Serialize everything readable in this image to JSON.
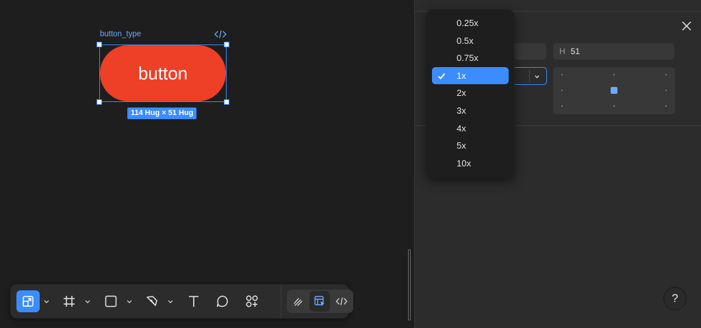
{
  "canvas": {
    "frame_name": "button_type",
    "button_label": "button",
    "size_badge": "114 Hug × 51 Hug"
  },
  "panel": {
    "h_label": "H",
    "h_value": "51"
  },
  "scale_dropdown": {
    "options": [
      "0.25x",
      "0.5x",
      "0.75x",
      "1x",
      "2x",
      "3x",
      "4x",
      "5x",
      "10x"
    ],
    "selected": "1x"
  },
  "toolbar": {
    "tools": [
      "move-tool",
      "frame-tool",
      "rectangle-tool",
      "pen-tool",
      "text-tool",
      "comment-tool",
      "components-tool"
    ],
    "modes": [
      "draw-mode",
      "design-mode",
      "dev-mode"
    ]
  },
  "help": {
    "label": "?"
  },
  "colors": {
    "accent": "#3b8cff",
    "button_fill": "#ee3f27",
    "canvas_bg": "#1e1e1e",
    "panel_bg": "#2c2c2c"
  }
}
